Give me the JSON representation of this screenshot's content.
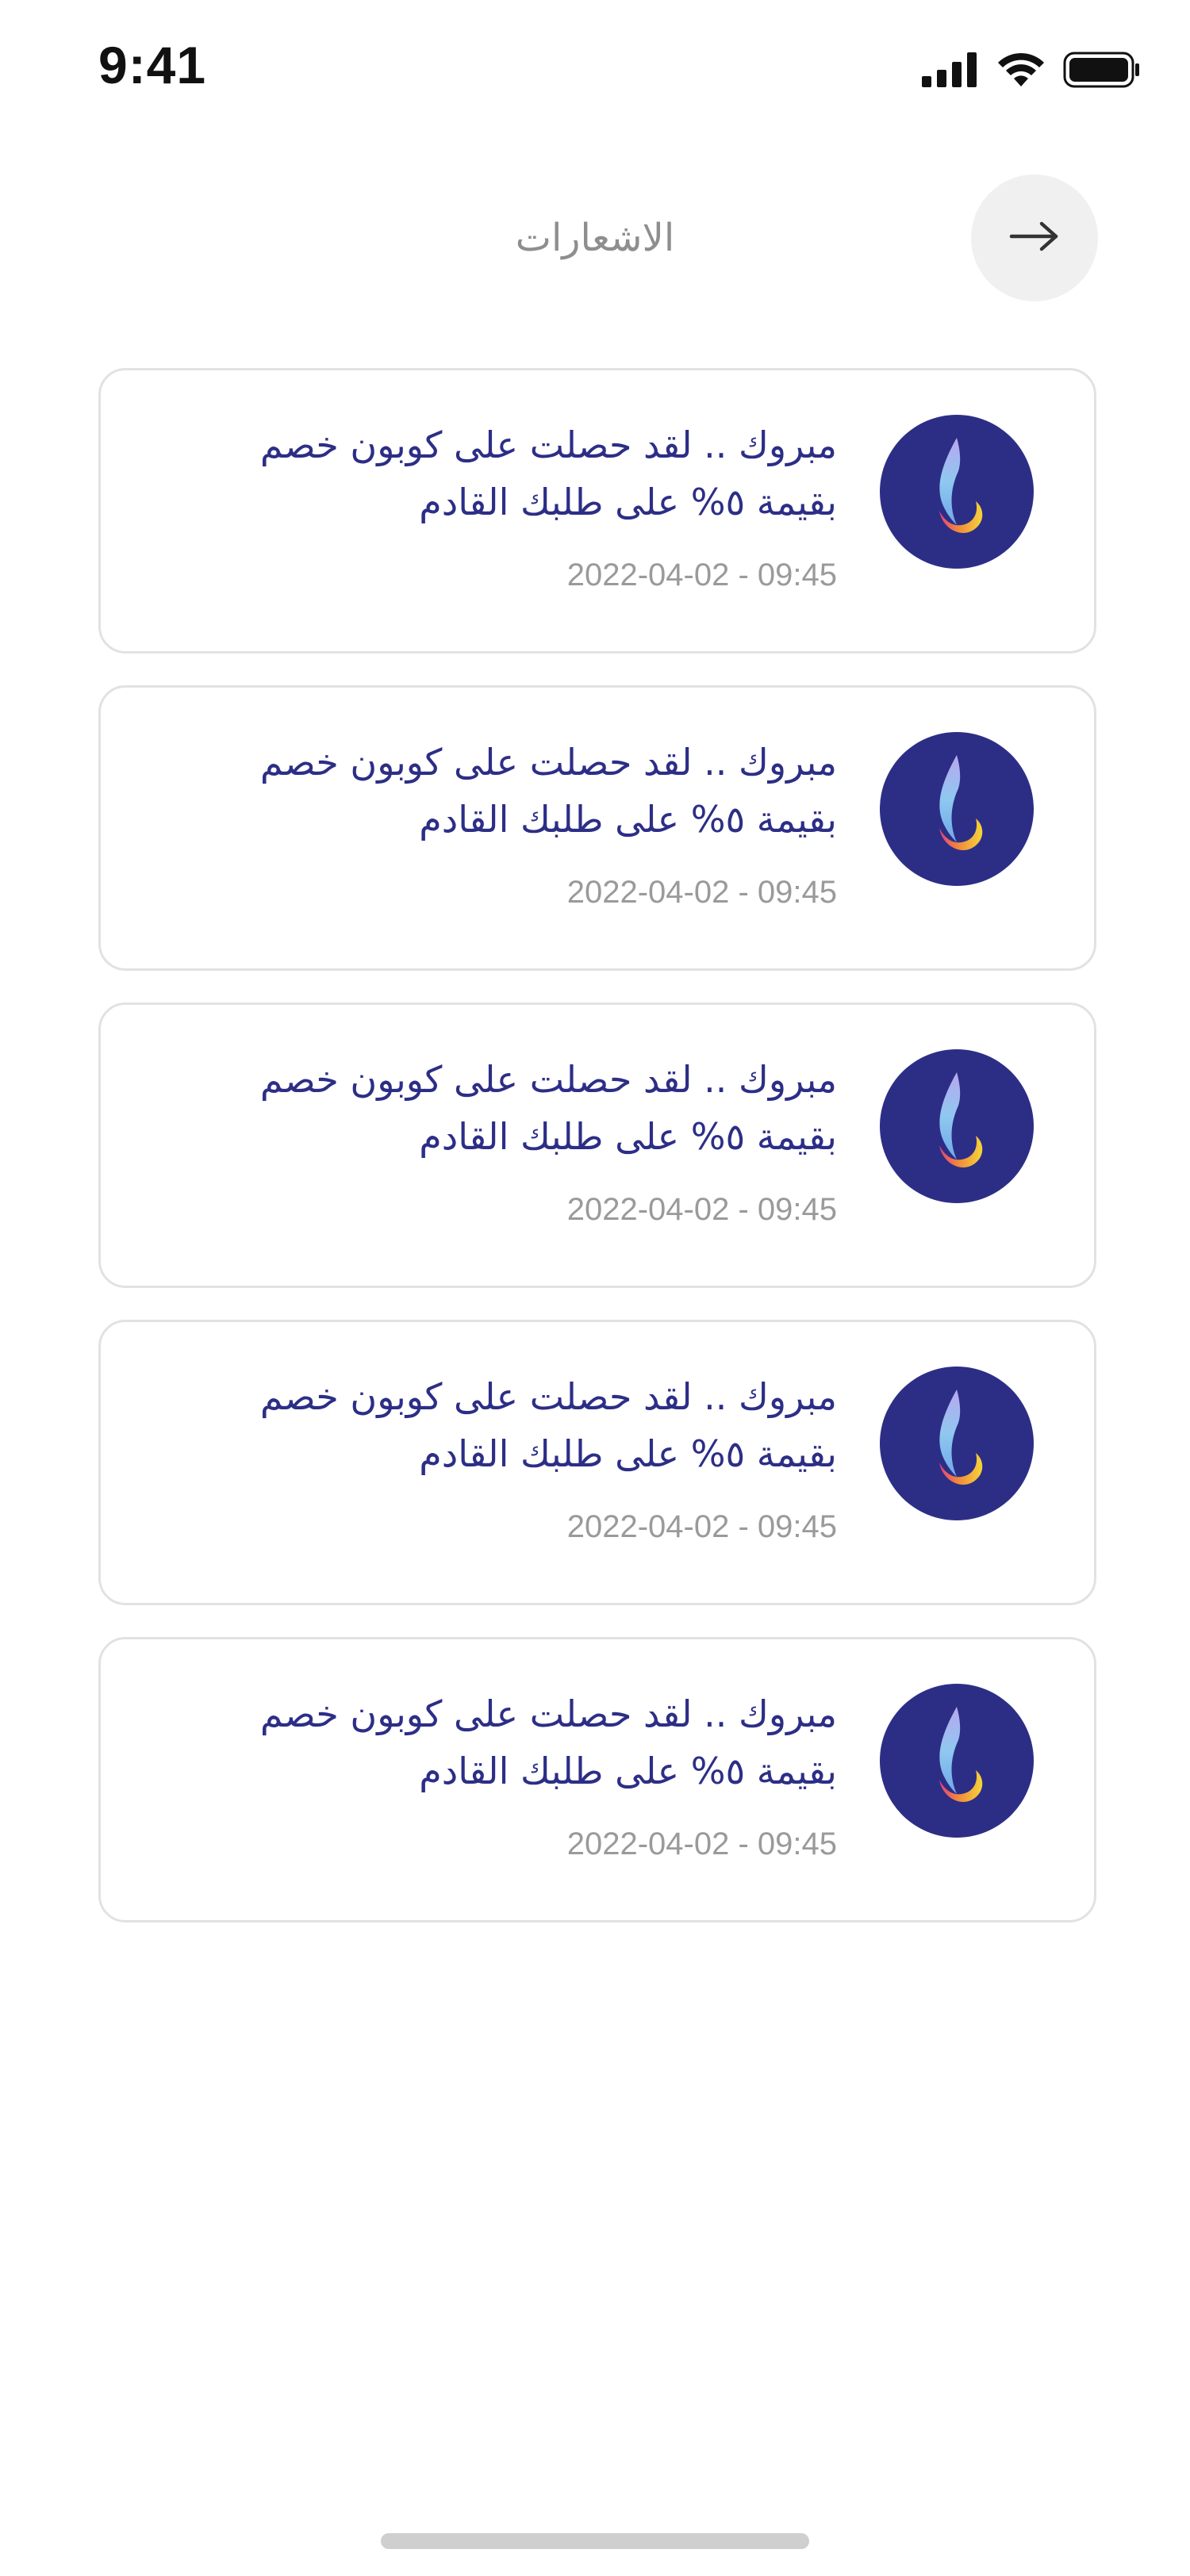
{
  "status_bar": {
    "time": "9:41",
    "icons": [
      "cellular-signal-icon",
      "wifi-icon",
      "battery-icon"
    ]
  },
  "header": {
    "title": "الاشعارات",
    "back_icon": "arrow-right-icon"
  },
  "notifications": [
    {
      "text": "مبروك .. لقد حصلت على كوبون خصم بقيمة ٥% على طلبك القادم",
      "time": "2022-04-02 - 09:45",
      "avatar_icon": "flame-logo-icon"
    },
    {
      "text": "مبروك .. لقد حصلت على كوبون خصم بقيمة ٥% على طلبك القادم",
      "time": "2022-04-02 - 09:45",
      "avatar_icon": "flame-logo-icon"
    },
    {
      "text": "مبروك .. لقد حصلت على كوبون خصم بقيمة ٥% على طلبك القادم",
      "time": "2022-04-02 - 09:45",
      "avatar_icon": "flame-logo-icon"
    },
    {
      "text": "مبروك .. لقد حصلت على كوبون خصم بقيمة ٥% على طلبك القادم",
      "time": "2022-04-02 - 09:45",
      "avatar_icon": "flame-logo-icon"
    },
    {
      "text": "مبروك .. لقد حصلت على كوبون خصم بقيمة ٥% على طلبك القادم",
      "time": "2022-04-02 - 09:45",
      "avatar_icon": "flame-logo-icon"
    }
  ],
  "colors": {
    "brand_navy": "#2c2e86",
    "title_gray": "#8e8e8e",
    "timestamp_gray": "#9a9a9a",
    "card_border": "#e2e2e2",
    "back_button_bg": "#f0f0f0"
  }
}
